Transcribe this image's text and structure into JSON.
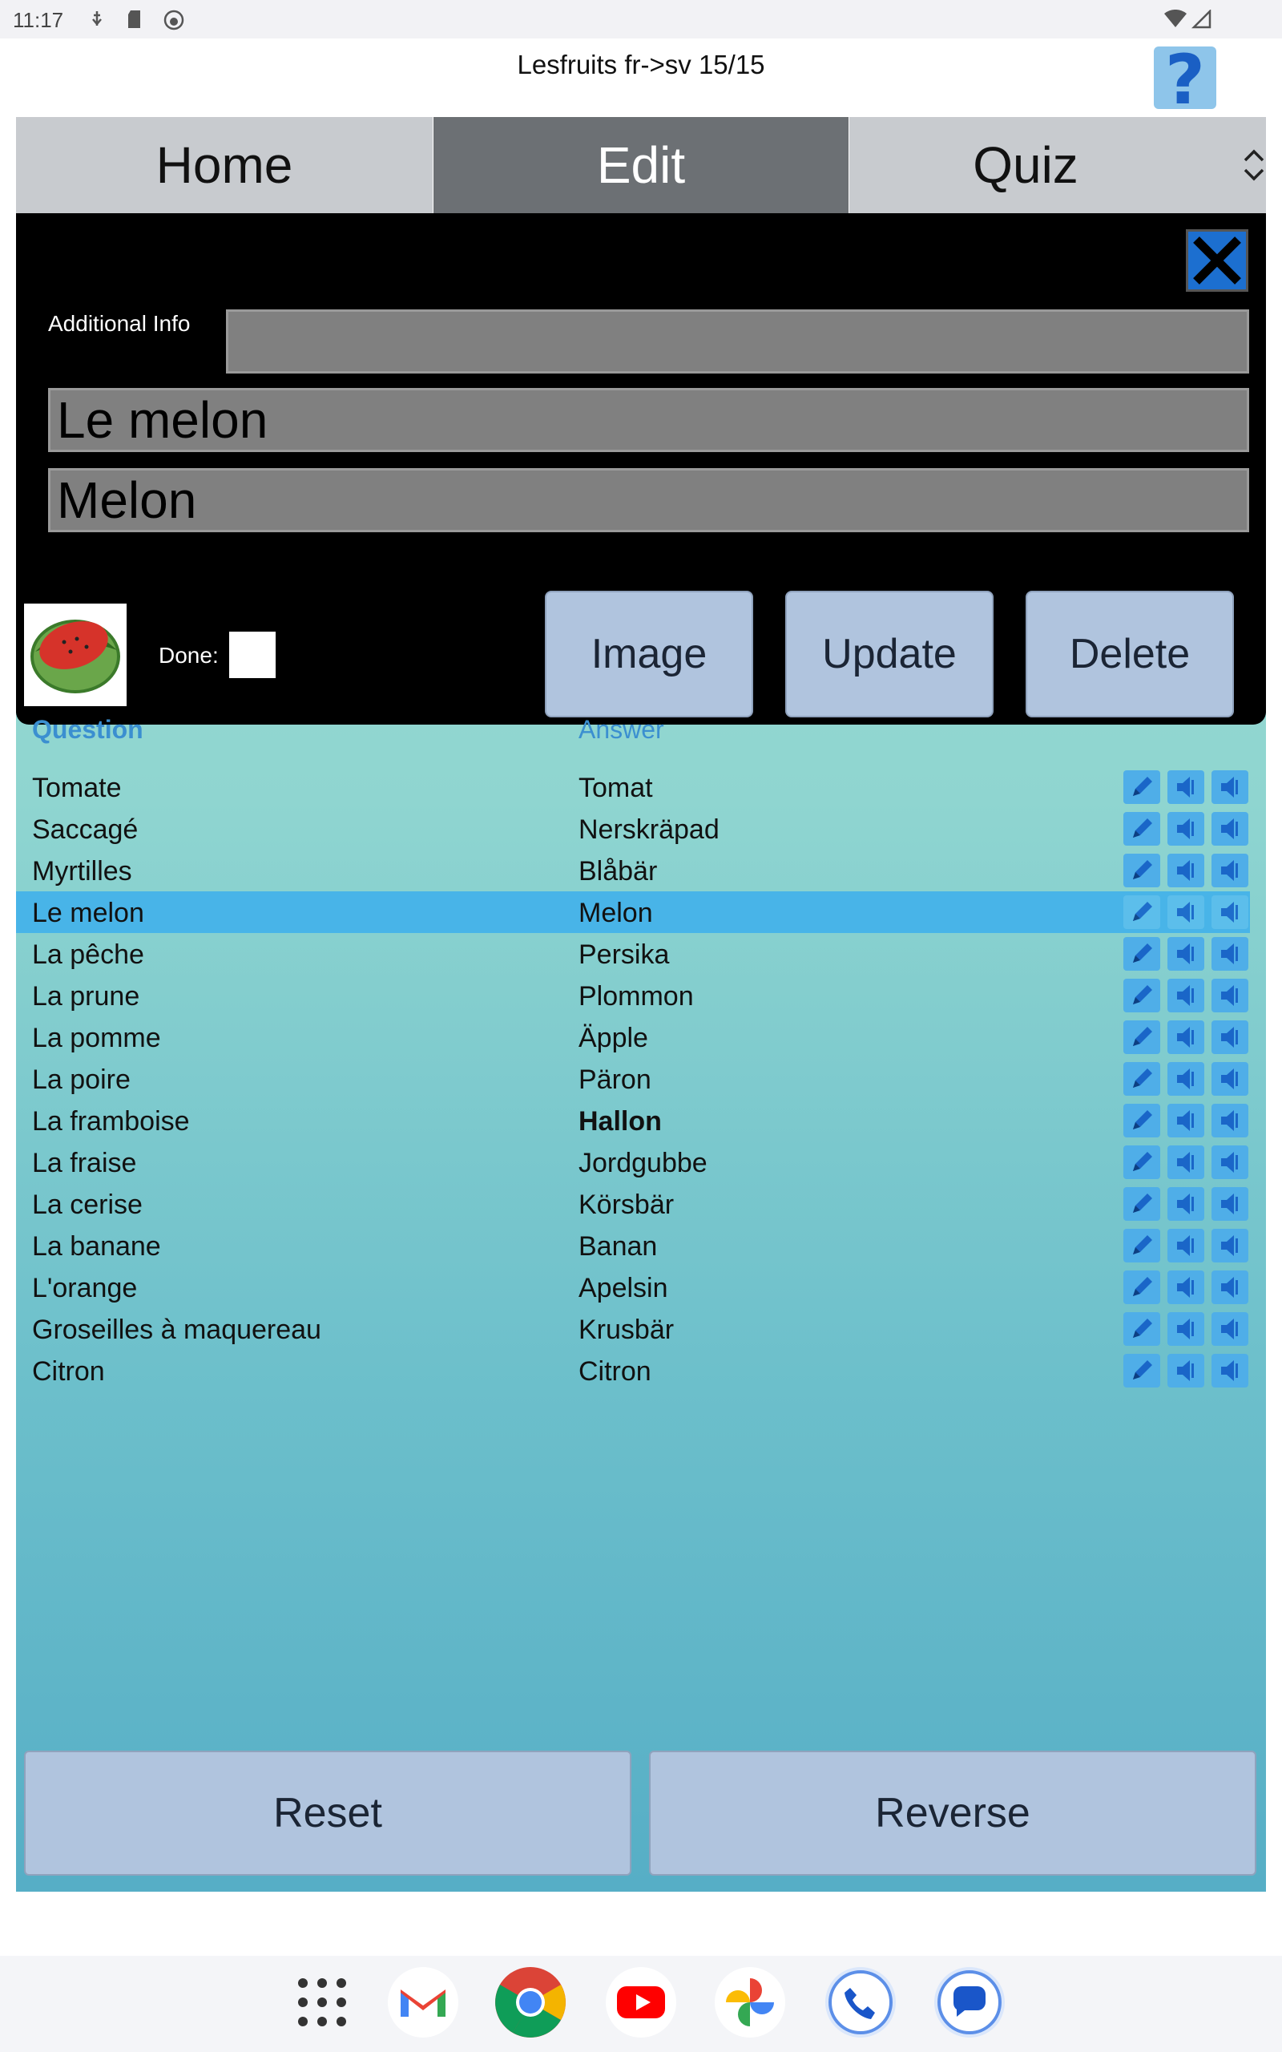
{
  "status_bar": {
    "time": "11:17"
  },
  "app": {
    "title": "Lesfruits fr->sv 15/15",
    "help_symbol": "?"
  },
  "tabs": [
    {
      "label": "Home"
    },
    {
      "label": "Edit"
    },
    {
      "label": "Quiz"
    }
  ],
  "edit_panel": {
    "additional_info_label": "Additional Info",
    "additional_info_value": "",
    "question_value": "Le melon",
    "answer_value": "Melon",
    "done_label": "Done:",
    "image_button": "Image",
    "update_button": "Update",
    "delete_button": "Delete"
  },
  "list": {
    "question_header": "Question",
    "answer_header": "Answer",
    "rows": [
      {
        "q": "Tomate",
        "a": "Tomat"
      },
      {
        "q": "Saccagé",
        "a": "Nerskräpad"
      },
      {
        "q": "Myrtilles",
        "a": "Blåbär"
      },
      {
        "q": "Le melon",
        "a": "Melon"
      },
      {
        "q": "La pêche",
        "a": "Persika"
      },
      {
        "q": "La prune",
        "a": "Plommon"
      },
      {
        "q": "La pomme",
        "a": "Äpple"
      },
      {
        "q": "La poire",
        "a": "Päron"
      },
      {
        "q": "La framboise",
        "a": "Hallon"
      },
      {
        "q": "La fraise",
        "a": "Jordgubbe"
      },
      {
        "q": "La cerise",
        "a": "Körsbär"
      },
      {
        "q": "La banane",
        "a": "Banan"
      },
      {
        "q": "L'orange",
        "a": "Apelsin"
      },
      {
        "q": "Groseilles à maquereau",
        "a": "Krusbär"
      },
      {
        "q": "Citron",
        "a": "Citron"
      }
    ]
  },
  "bottom_buttons": {
    "reset": "Reset",
    "reverse": "Reverse"
  },
  "colors": {
    "accent": "#48b4e8",
    "panel_bg": "#000000",
    "button_bg": "#b0c4de",
    "active_tab": "#6c7074"
  },
  "icons": [
    "edit-icon",
    "speaker-icon",
    "close-icon",
    "help-icon",
    "watermelon-image"
  ]
}
